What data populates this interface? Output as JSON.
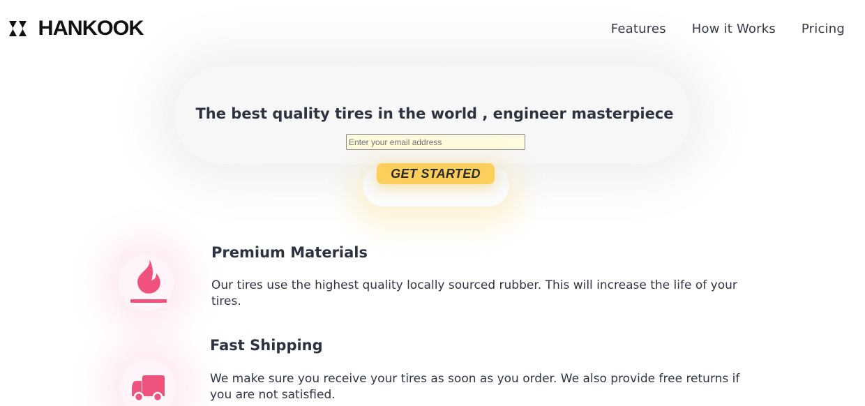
{
  "header": {
    "logo_text": "HANKOOK",
    "logo_icon": "hankook-chevron-logo",
    "nav": [
      {
        "label": "Features"
      },
      {
        "label": "How it Works"
      },
      {
        "label": "Pricing"
      }
    ]
  },
  "hero": {
    "title": "The best quality tires in the world , engineer masterpiece",
    "email_placeholder": "Enter your email address",
    "email_value": "",
    "cta_label": "GET STARTED"
  },
  "features": [
    {
      "icon": "flame-icon",
      "title": "Premium Materials",
      "text": "Our tires use the highest quality locally sourced rubber. This will increase the life of your tires."
    },
    {
      "icon": "truck-icon",
      "title": "Fast Shipping",
      "text": "We make sure you receive your tires as soon as you order. We also provide free returns if you are not satisfied."
    }
  ],
  "colors": {
    "accent_pink": "#f0527e",
    "cta_yellow": "#fccf5c",
    "text_dark": "#2c3240",
    "input_bg": "#fffbe0"
  }
}
